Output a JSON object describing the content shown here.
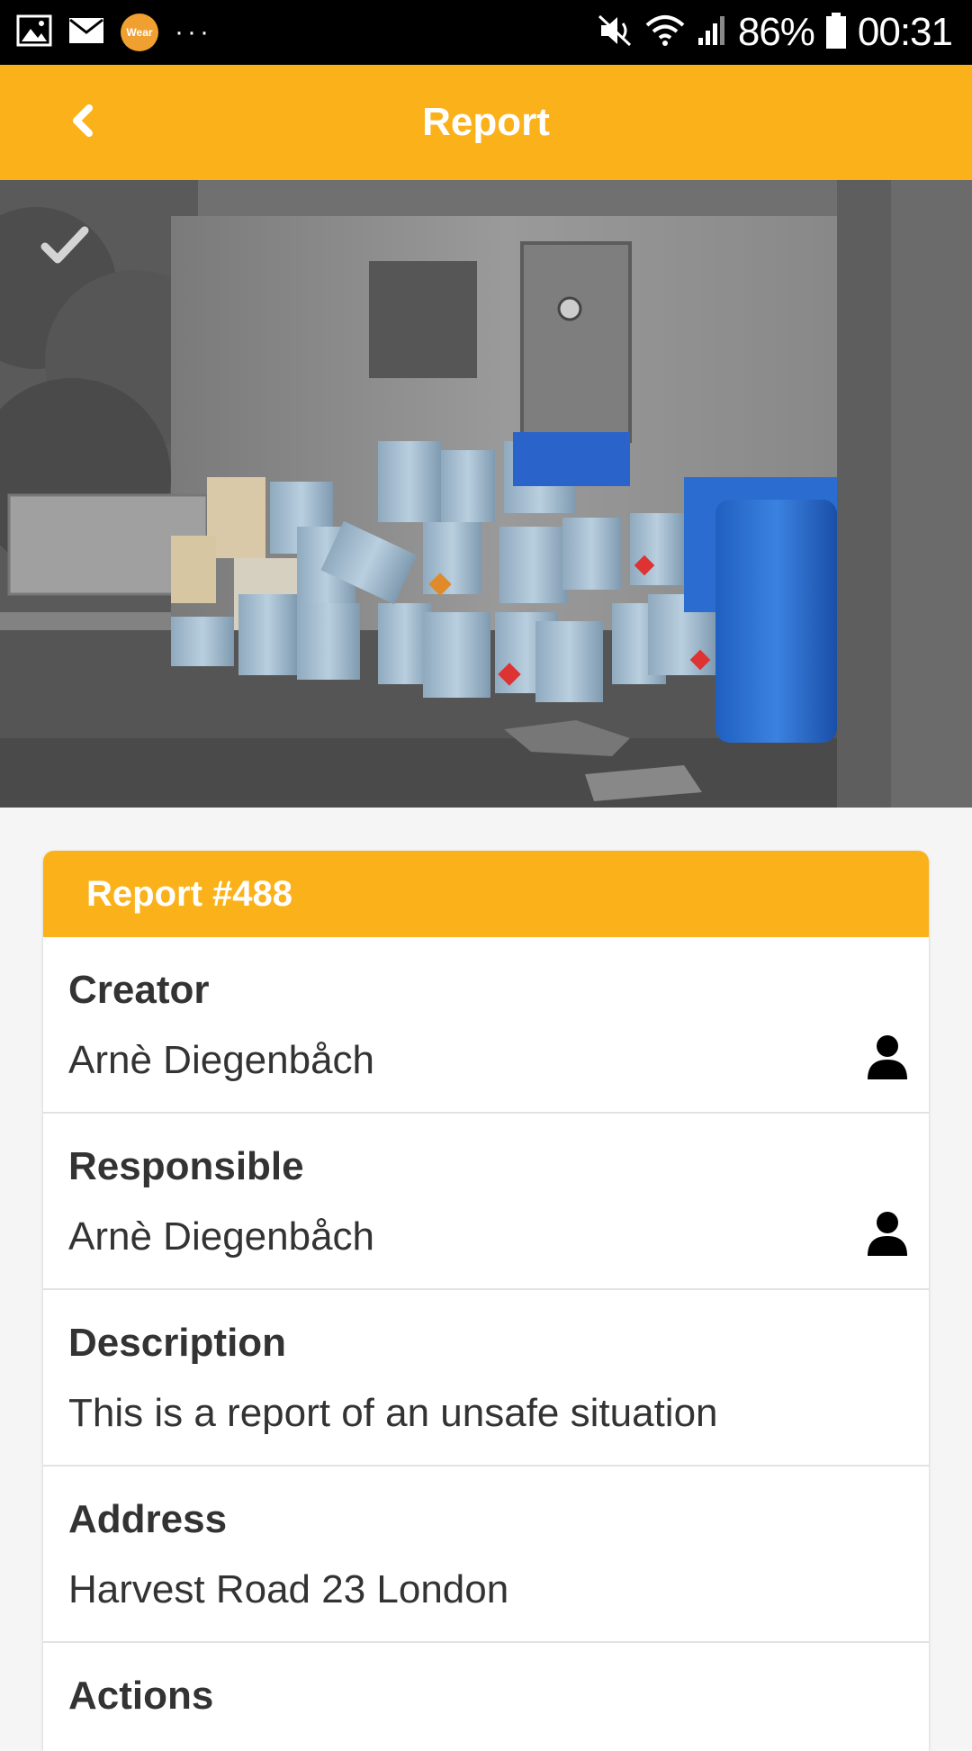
{
  "status_bar": {
    "wear_label": "Wear",
    "more_dots": "···",
    "battery": "86%",
    "time": "00:31"
  },
  "app_bar": {
    "title": "Report"
  },
  "report": {
    "header": "Report #488",
    "fields": [
      {
        "label": "Creator",
        "value": "Arnè Diegenbåch"
      },
      {
        "label": "Responsible",
        "value": "Arnè Diegenbåch"
      },
      {
        "label": "Description",
        "value": "This is a report of an unsafe situation"
      },
      {
        "label": "Address",
        "value": "Harvest Road 23 London"
      },
      {
        "label": "Actions",
        "value": ""
      }
    ]
  },
  "colors": {
    "accent": "#fbb11a",
    "text": "#333333",
    "background": "#f5f5f5"
  },
  "icons": [
    "gallery-icon",
    "mail-icon",
    "wear-icon",
    "mute-icon",
    "wifi-icon",
    "signal-icon",
    "battery-icon",
    "back-icon",
    "check-icon",
    "person-icon"
  ]
}
